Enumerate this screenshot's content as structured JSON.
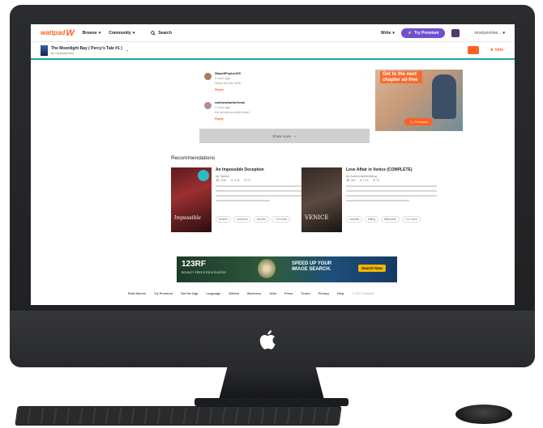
{
  "header": {
    "logo_text": "wattpad",
    "logo_mark": "W",
    "nav": [
      {
        "label": "Browse"
      },
      {
        "label": "Community"
      }
    ],
    "search_label": "Search",
    "write_label": "Write",
    "premium_label": "Try Premium",
    "username": "ninetysixnine..."
  },
  "story": {
    "title": "The Moonlight Bay ( Percy's Tale #1 )",
    "author": "by ninetysixnine",
    "vote_label": "Vote"
  },
  "comments": [
    {
      "name": "WayoftFaylor105",
      "line1": "1 hour ago",
      "line2": "Show me the Drift",
      "reply": "Reply",
      "more": "..."
    },
    {
      "name": "rainbowbarbiefreak",
      "line1": "1 hour ago",
      "line2": "He serves proudly fresh~",
      "reply": "Reply",
      "more": "..."
    }
  ],
  "show_more_label": "Show more",
  "ad_top": {
    "headline": "Get to the next chapter ad-free",
    "button": "Try Premium"
  },
  "recommendations": {
    "heading": "Recommendations",
    "items": [
      {
        "title": "An Impossible Deception",
        "author": "by Syrtes",
        "stats": [
          "143K",
          "5.5K",
          "22"
        ],
        "cover_text": "Impossible",
        "tags": [
          "brother",
          "romance",
          "secrets",
          "+15 more"
        ]
      },
      {
        "title": "Love Affair in Venice (COMPLETE)",
        "author": "by AuthorJamieWang",
        "stats": [
          "18K",
          "1.2K",
          "15"
        ],
        "cover_text": "VENICE",
        "tags": [
          "scandal",
          "billing",
          "billionaire",
          "+10 more"
        ]
      }
    ]
  },
  "banner": {
    "logo": "123RF",
    "sub": "ROYALTY FREE STOCK PHOTOS",
    "headline_line1": "SPEED UP YOUR",
    "headline_line2": "IMAGE SEARCH.",
    "button": "Search Now"
  },
  "footer": {
    "links": [
      "Paid Stories",
      "Try Premium",
      "Get the App",
      "Language",
      "Writers",
      "Business",
      "Jobs",
      "Press",
      "Terms",
      "Privacy",
      "Help"
    ],
    "copyright": "© 2021 Wattpad"
  }
}
